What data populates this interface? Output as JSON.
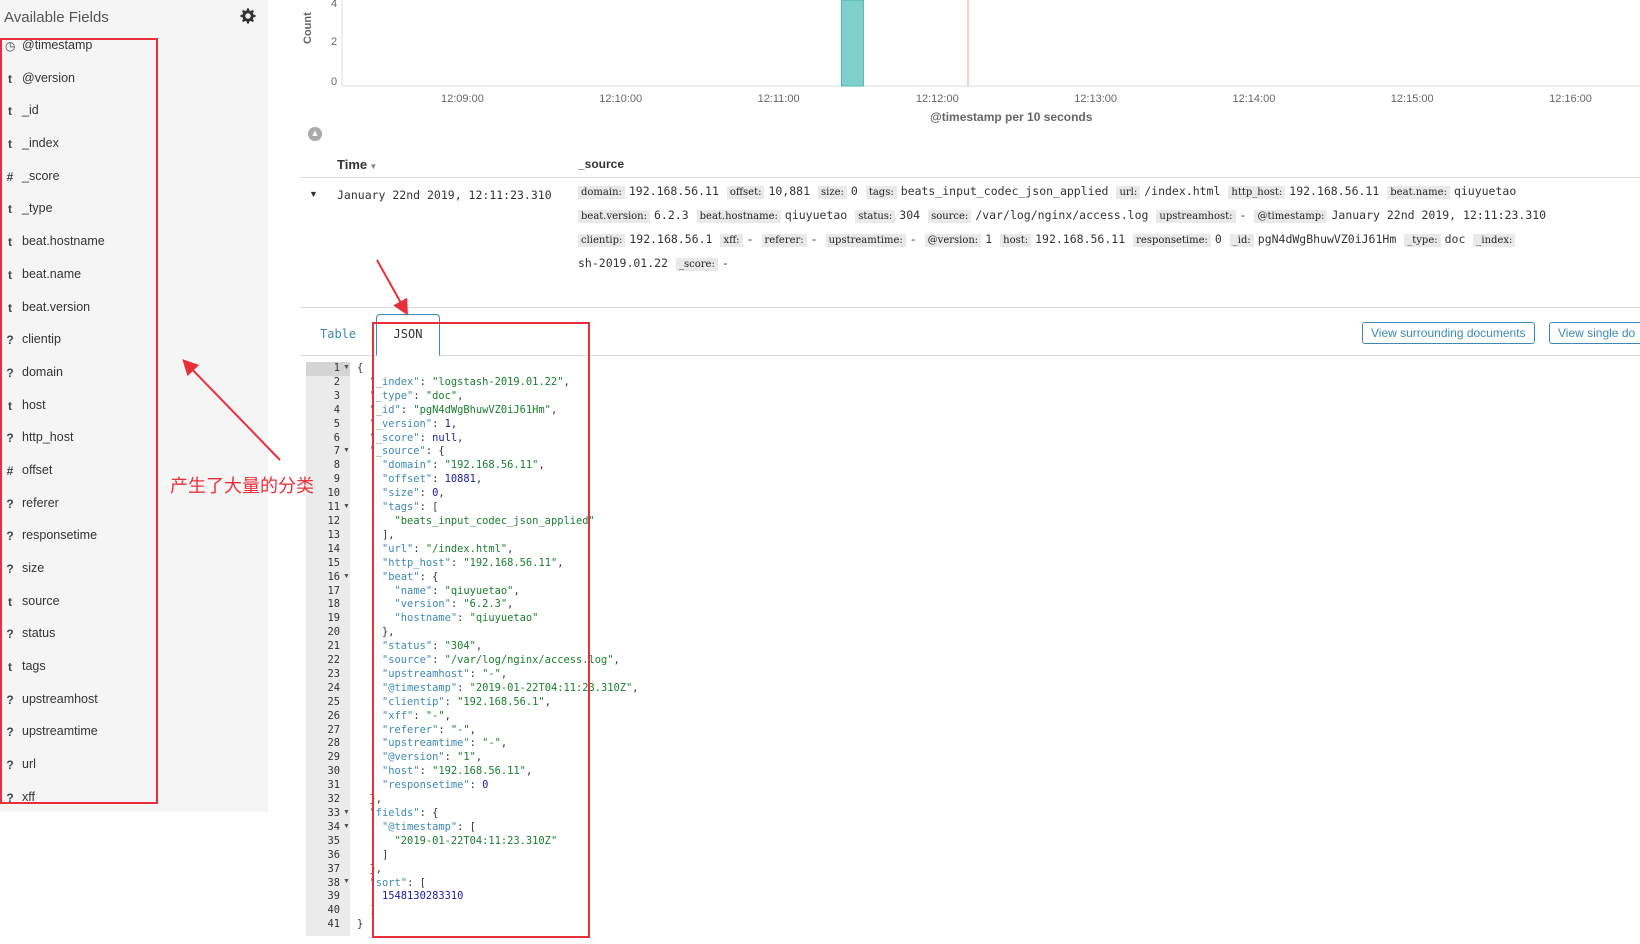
{
  "sidebar": {
    "title": "Available Fields",
    "fields": [
      {
        "type": "◷",
        "name": "@timestamp"
      },
      {
        "type": "t",
        "name": "@version"
      },
      {
        "type": "t",
        "name": "_id"
      },
      {
        "type": "t",
        "name": "_index"
      },
      {
        "type": "#",
        "name": "_score"
      },
      {
        "type": "t",
        "name": "_type"
      },
      {
        "type": "t",
        "name": "beat.hostname"
      },
      {
        "type": "t",
        "name": "beat.name"
      },
      {
        "type": "t",
        "name": "beat.version"
      },
      {
        "type": "?",
        "name": "clientip"
      },
      {
        "type": "?",
        "name": "domain"
      },
      {
        "type": "t",
        "name": "host"
      },
      {
        "type": "?",
        "name": "http_host"
      },
      {
        "type": "#",
        "name": "offset"
      },
      {
        "type": "?",
        "name": "referer"
      },
      {
        "type": "?",
        "name": "responsetime"
      },
      {
        "type": "?",
        "name": "size"
      },
      {
        "type": "t",
        "name": "source"
      },
      {
        "type": "?",
        "name": "status"
      },
      {
        "type": "t",
        "name": "tags"
      },
      {
        "type": "?",
        "name": "upstreamhost"
      },
      {
        "type": "?",
        "name": "upstreamtime"
      },
      {
        "type": "?",
        "name": "url"
      },
      {
        "type": "?",
        "name": "xff"
      }
    ]
  },
  "annotation": {
    "text": "产生了大量的分类",
    "color": "#e8303a"
  },
  "histogram": {
    "y_label": "Count",
    "y_ticks": [
      "4",
      "2",
      "0"
    ],
    "x_ticks": [
      "12:09:00",
      "12:10:00",
      "12:11:00",
      "12:12:00",
      "12:13:00",
      "12:14:00",
      "12:15:00",
      "12:16:00"
    ],
    "x_title": "@timestamp per 10 seconds",
    "bar_color": "#7fd0cc",
    "marker_color": "#f0a0a0"
  },
  "chart_data": {
    "type": "bar",
    "categories": [
      "12:11:20"
    ],
    "values": [
      5
    ],
    "xlabel": "@timestamp per 10 seconds",
    "ylabel": "Count",
    "ylim": [
      0,
      5
    ]
  },
  "doc_table": {
    "col_time": "Time",
    "col_source": "_source",
    "row": {
      "time": "January 22nd 2019, 12:11:23.310",
      "source_lines": [
        [
          {
            "k": "domain:",
            "v": "192.168.56.11"
          },
          {
            "k": "offset:",
            "v": "10,881"
          },
          {
            "k": "size:",
            "v": "0"
          },
          {
            "k": "tags:",
            "v": "beats_input_codec_json_applied"
          },
          {
            "k": "url:",
            "v": "/index.html"
          },
          {
            "k": "http_host:",
            "v": "192.168.56.11"
          },
          {
            "k": "beat.name:",
            "v": "qiuyuetao"
          }
        ],
        [
          {
            "k": "beat.version:",
            "v": "6.2.3"
          },
          {
            "k": "beat.hostname:",
            "v": "qiuyuetao"
          },
          {
            "k": "status:",
            "v": "304"
          },
          {
            "k": "source:",
            "v": "/var/log/nginx/access.log"
          },
          {
            "k": "upstreamhost:",
            "v": "-"
          },
          {
            "k": "@timestamp:",
            "v": "January 22nd 2019, 12:11:23.310"
          }
        ],
        [
          {
            "k": "clientip:",
            "v": "192.168.56.1"
          },
          {
            "k": "xff:",
            "v": "-"
          },
          {
            "k": "referer:",
            "v": "-"
          },
          {
            "k": "upstreamtime:",
            "v": "-"
          },
          {
            "k": "@version:",
            "v": "1"
          },
          {
            "k": "host:",
            "v": "192.168.56.11"
          },
          {
            "k": "responsetime:",
            "v": "0"
          },
          {
            "k": "_id:",
            "v": "pgN4dWgBhuwVZ0iJ61Hm"
          },
          {
            "k": "_type:",
            "v": "doc"
          },
          {
            "k": "_index:",
            "v": ""
          }
        ],
        [
          {
            "k": "",
            "v": "sh-2019.01.22"
          },
          {
            "k": "_score:",
            "v": "-"
          }
        ]
      ]
    }
  },
  "tabs": {
    "table": "Table",
    "json": "JSON",
    "view_surrounding": "View surrounding documents",
    "view_single": "View single do"
  },
  "json_view": {
    "lines": [
      "{",
      "  \"_index\": \"logstash-2019.01.22\",",
      "  \"_type\": \"doc\",",
      "  \"_id\": \"pgN4dWgBhuwVZ0iJ61Hm\",",
      "  \"_version\": 1,",
      "  \"_score\": null,",
      "  \"_source\": {",
      "    \"domain\": \"192.168.56.11\",",
      "    \"offset\": 10881,",
      "    \"size\": 0,",
      "    \"tags\": [",
      "      \"beats_input_codec_json_applied\"",
      "    ],",
      "    \"url\": \"/index.html\",",
      "    \"http_host\": \"192.168.56.11\",",
      "    \"beat\": {",
      "      \"name\": \"qiuyuetao\",",
      "      \"version\": \"6.2.3\",",
      "      \"hostname\": \"qiuyuetao\"",
      "    },",
      "    \"status\": \"304\",",
      "    \"source\": \"/var/log/nginx/access.log\",",
      "    \"upstreamhost\": \"-\",",
      "    \"@timestamp\": \"2019-01-22T04:11:23.310Z\",",
      "    \"clientip\": \"192.168.56.1\",",
      "    \"xff\": \"-\",",
      "    \"referer\": \"-\",",
      "    \"upstreamtime\": \"-\",",
      "    \"@version\": \"1\",",
      "    \"host\": \"192.168.56.11\",",
      "    \"responsetime\": 0",
      "  },",
      "  \"fields\": {",
      "    \"@timestamp\": [",
      "      \"2019-01-22T04:11:23.310Z\"",
      "    ]",
      "  },",
      "  \"sort\": [",
      "    1548130283310",
      "  ]",
      "}"
    ],
    "fold_lines": [
      1,
      7,
      11,
      16,
      33,
      34,
      38
    ]
  }
}
